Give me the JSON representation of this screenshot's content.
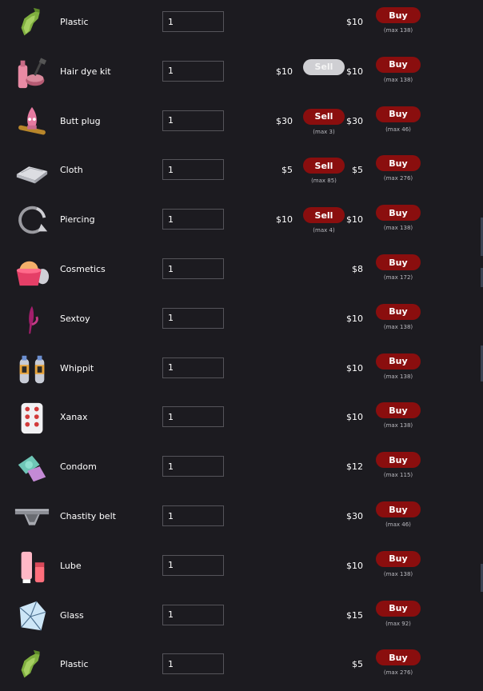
{
  "rows": [
    {
      "name": "Plastic",
      "icon": "plastic-icon",
      "qty": "1",
      "sell_price": "",
      "sell_label": "",
      "sell_max": "",
      "buy_price": "$10",
      "buy_label": "Buy",
      "buy_max": "(max 138)"
    },
    {
      "name": "Hair dye kit",
      "icon": "hair-dye-kit-icon",
      "qty": "1",
      "sell_price": "$10",
      "sell_label": "Sell",
      "sell_max": "",
      "sell_disabled": true,
      "buy_price": "$10",
      "buy_label": "Buy",
      "buy_max": "(max 138)"
    },
    {
      "name": "Butt plug",
      "icon": "butt-plug-icon",
      "qty": "1",
      "sell_price": "$30",
      "sell_label": "Sell",
      "sell_max": "(max 3)",
      "buy_price": "$30",
      "buy_label": "Buy",
      "buy_max": "(max 46)"
    },
    {
      "name": "Cloth",
      "icon": "cloth-icon",
      "qty": "1",
      "sell_price": "$5",
      "sell_label": "Sell",
      "sell_max": "(max 85)",
      "buy_price": "$5",
      "buy_label": "Buy",
      "buy_max": "(max 276)"
    },
    {
      "name": "Piercing",
      "icon": "piercing-icon",
      "qty": "1",
      "sell_price": "$10",
      "sell_label": "Sell",
      "sell_max": "(max 4)",
      "buy_price": "$10",
      "buy_label": "Buy",
      "buy_max": "(max 138)"
    },
    {
      "name": "Cosmetics",
      "icon": "cosmetics-icon",
      "qty": "1",
      "sell_price": "",
      "sell_label": "",
      "sell_max": "",
      "buy_price": "$8",
      "buy_label": "Buy",
      "buy_max": "(max 172)"
    },
    {
      "name": "Sextoy",
      "icon": "sextoy-icon",
      "qty": "1",
      "sell_price": "",
      "sell_label": "",
      "sell_max": "",
      "buy_price": "$10",
      "buy_label": "Buy",
      "buy_max": "(max 138)"
    },
    {
      "name": "Whippit",
      "icon": "whippit-icon",
      "qty": "1",
      "sell_price": "",
      "sell_label": "",
      "sell_max": "",
      "buy_price": "$10",
      "buy_label": "Buy",
      "buy_max": "(max 138)"
    },
    {
      "name": "Xanax",
      "icon": "xanax-icon",
      "qty": "1",
      "sell_price": "",
      "sell_label": "",
      "sell_max": "",
      "buy_price": "$10",
      "buy_label": "Buy",
      "buy_max": "(max 138)"
    },
    {
      "name": "Condom",
      "icon": "condom-icon",
      "qty": "1",
      "sell_price": "",
      "sell_label": "",
      "sell_max": "",
      "buy_price": "$12",
      "buy_label": "Buy",
      "buy_max": "(max 115)"
    },
    {
      "name": "Chastity belt",
      "icon": "chastity-belt-icon",
      "qty": "1",
      "sell_price": "",
      "sell_label": "",
      "sell_max": "",
      "buy_price": "$30",
      "buy_label": "Buy",
      "buy_max": "(max 46)"
    },
    {
      "name": "Lube",
      "icon": "lube-icon",
      "qty": "1",
      "sell_price": "",
      "sell_label": "",
      "sell_max": "",
      "buy_price": "$10",
      "buy_label": "Buy",
      "buy_max": "(max 138)"
    },
    {
      "name": "Glass",
      "icon": "glass-icon",
      "qty": "1",
      "sell_price": "",
      "sell_label": "",
      "sell_max": "",
      "buy_price": "$15",
      "buy_label": "Buy",
      "buy_max": "(max 92)"
    },
    {
      "name": "Plastic",
      "icon": "plastic-icon",
      "qty": "1",
      "sell_price": "",
      "sell_label": "",
      "sell_max": "",
      "buy_price": "$5",
      "buy_label": "Buy",
      "buy_max": "(max 276)"
    }
  ],
  "colors": {
    "background": "#1c1b20",
    "button_red": "#8a0e0e",
    "button_disabled": "#cfcfd3",
    "text": "#ffffff"
  }
}
